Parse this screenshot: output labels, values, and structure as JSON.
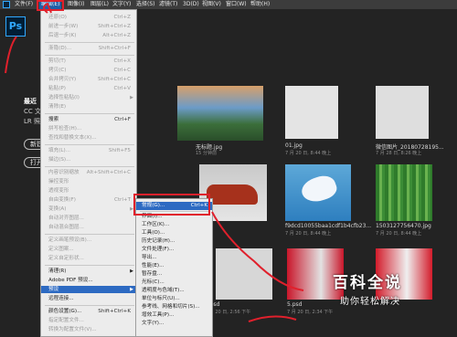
{
  "menubar": {
    "items": [
      "文件(F)",
      "编辑(E)",
      "图像(I)",
      "图层(L)",
      "文字(Y)",
      "选择(S)",
      "滤镜(T)",
      "3D(D)",
      "视图(V)",
      "窗口(W)",
      "帮助(H)"
    ]
  },
  "app": {
    "logo": "Ps"
  },
  "sidebar": {
    "heading": "最近",
    "item1": "CC 文",
    "item2": "LR 照"
  },
  "buttons": {
    "new": "新建",
    "open": "打开"
  },
  "thumbs": [
    {
      "name": "无标题.jpg",
      "meta": "15 分钟前"
    },
    {
      "name": "01.jpg",
      "meta": "7 月 20 日, 8:44 晚上"
    },
    {
      "name": "微信图片_20180728195...",
      "meta": "7 月 28 日, 8:26 晚上"
    },
    {
      "name": "f9dcd10055baa1cdf1b4cfb23...",
      "meta": "7 月 20 日, 8:44 晚上"
    },
    {
      "name": "1503127756470.jpg",
      "meta": "7 月 20 日, 8:44 晚上"
    },
    {
      "name": "3.psd",
      "meta": "7 月 20 日, 2:56 下午"
    },
    {
      "name": "5.psd",
      "meta": "7 月 20 日, 2:34 下午"
    }
  ],
  "edit_menu": [
    {
      "label": "还原(O)",
      "shortcut": "Ctrl+Z",
      "disabled": true
    },
    {
      "label": "前进一步(W)",
      "shortcut": "Shift+Ctrl+Z",
      "disabled": true
    },
    {
      "label": "后退一步(K)",
      "shortcut": "Alt+Ctrl+Z",
      "disabled": true
    },
    {
      "label": "渐隐(D)...",
      "shortcut": "Shift+Ctrl+F",
      "disabled": true
    },
    {
      "label": "剪切(T)",
      "shortcut": "Ctrl+X",
      "disabled": true
    },
    {
      "label": "拷贝(C)",
      "shortcut": "Ctrl+C",
      "disabled": true
    },
    {
      "label": "合并拷贝(Y)",
      "shortcut": "Shift+Ctrl+C",
      "disabled": true
    },
    {
      "label": "粘贴(P)",
      "shortcut": "Ctrl+V",
      "disabled": true
    },
    {
      "label": "选择性粘贴(I)",
      "shortcut": "",
      "disabled": true
    },
    {
      "label": "清除(E)",
      "shortcut": "",
      "disabled": true
    },
    {
      "label": "搜索",
      "shortcut": "Ctrl+F",
      "disabled": false
    },
    {
      "label": "拼写检查(H)...",
      "shortcut": "",
      "disabled": true
    },
    {
      "label": "查找和替换文本(X)...",
      "shortcut": "",
      "disabled": true
    },
    {
      "label": "填充(L)...",
      "shortcut": "Shift+F5",
      "disabled": true
    },
    {
      "label": "描边(S)...",
      "shortcut": "",
      "disabled": true
    },
    {
      "label": "内容识别缩放",
      "shortcut": "Alt+Shift+Ctrl+C",
      "disabled": true
    },
    {
      "label": "操控变形",
      "shortcut": "",
      "disabled": true
    },
    {
      "label": "透视变形",
      "shortcut": "",
      "disabled": true
    },
    {
      "label": "自由变换(F)",
      "shortcut": "Ctrl+T",
      "disabled": true
    },
    {
      "label": "变换(A)",
      "shortcut": "",
      "disabled": true
    },
    {
      "label": "自动对齐图层...",
      "shortcut": "",
      "disabled": true
    },
    {
      "label": "自动混合图层...",
      "shortcut": "",
      "disabled": true
    },
    {
      "label": "定义画笔预设(B)...",
      "shortcut": "",
      "disabled": true
    },
    {
      "label": "定义图案...",
      "shortcut": "",
      "disabled": true
    },
    {
      "label": "定义自定形状...",
      "shortcut": "",
      "disabled": true
    },
    {
      "label": "清理(R)",
      "shortcut": "",
      "disabled": false
    },
    {
      "label": "Adobe PDF 预设...",
      "shortcut": "",
      "disabled": false
    },
    {
      "label": "预设",
      "shortcut": "",
      "disabled": false
    },
    {
      "label": "远程连接...",
      "shortcut": "",
      "disabled": false
    },
    {
      "label": "颜色设置(G)...",
      "shortcut": "Shift+Ctrl+K",
      "disabled": false
    },
    {
      "label": "指定配置文件...",
      "shortcut": "",
      "disabled": true
    },
    {
      "label": "转换为配置文件(V)...",
      "shortcut": "",
      "disabled": true
    }
  ],
  "preferences_menu": [
    {
      "label": "常规(G)...",
      "shortcut": "Ctrl+K"
    },
    {
      "label": "界面(I)...",
      "shortcut": ""
    },
    {
      "label": "工作区(K)...",
      "shortcut": ""
    },
    {
      "label": "工具(O)...",
      "shortcut": ""
    },
    {
      "label": "历史记录(H)...",
      "shortcut": ""
    },
    {
      "label": "文件处理(F)...",
      "shortcut": ""
    },
    {
      "label": "导出...",
      "shortcut": ""
    },
    {
      "label": "性能(E)...",
      "shortcut": ""
    },
    {
      "label": "暂存盘...",
      "shortcut": ""
    },
    {
      "label": "光标(C)...",
      "shortcut": ""
    },
    {
      "label": "透明度与色域(T)...",
      "shortcut": ""
    },
    {
      "label": "单位与标尺(U)...",
      "shortcut": ""
    },
    {
      "label": "参考线、网格和切片(S)...",
      "shortcut": ""
    },
    {
      "label": "增效工具(P)...",
      "shortcut": ""
    },
    {
      "label": "文字(Y)...",
      "shortcut": ""
    }
  ],
  "watermark": {
    "title": "百科全说",
    "subtitle": "助你轻松解决"
  },
  "colors": {
    "highlight": "#2d6ac2",
    "annotation": "#e0202c",
    "ps_blue": "#31a8ff"
  }
}
